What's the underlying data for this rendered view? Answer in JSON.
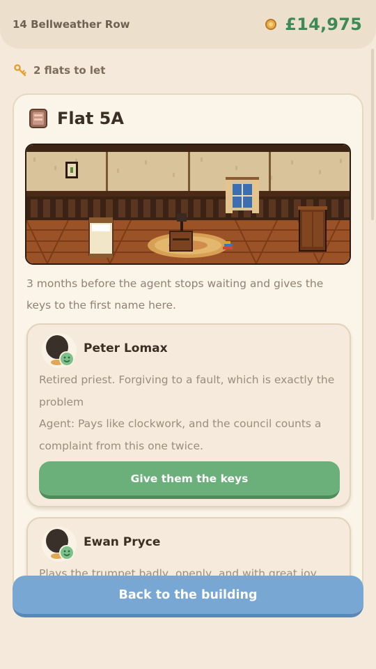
{
  "header": {
    "address": "14 Bellweather Row",
    "balance": "£14,975",
    "coin_icon": "coin-icon"
  },
  "vacancy": {
    "text": "2 flats to let",
    "icon": "key-icon"
  },
  "flat": {
    "title": "Flat 5A",
    "icon": "door-icon",
    "scene": "room-illustration",
    "description": "3 months before the agent stops waiting and gives the keys to the first name here."
  },
  "applicants": [
    {
      "name": "Peter Lomax",
      "mood": "happy",
      "lines": [
        "Retired priest. Forgiving to a fault, which is exactly the",
        "problem",
        "Agent: Pays like clockwork, and the council counts a",
        "complaint from this one twice."
      ],
      "button": "Give them the keys"
    },
    {
      "name": "Ewan Pryce",
      "mood": "happy",
      "lines": [
        "Plays the trumpet badly, openly, and with great joy."
      ]
    }
  ],
  "footer": {
    "back_label": "Back to the building"
  },
  "colors": {
    "background": "#f4e9da",
    "money_green": "#3e8a55",
    "primary_green": "#6bb07a",
    "back_blue": "#79a7d3"
  }
}
